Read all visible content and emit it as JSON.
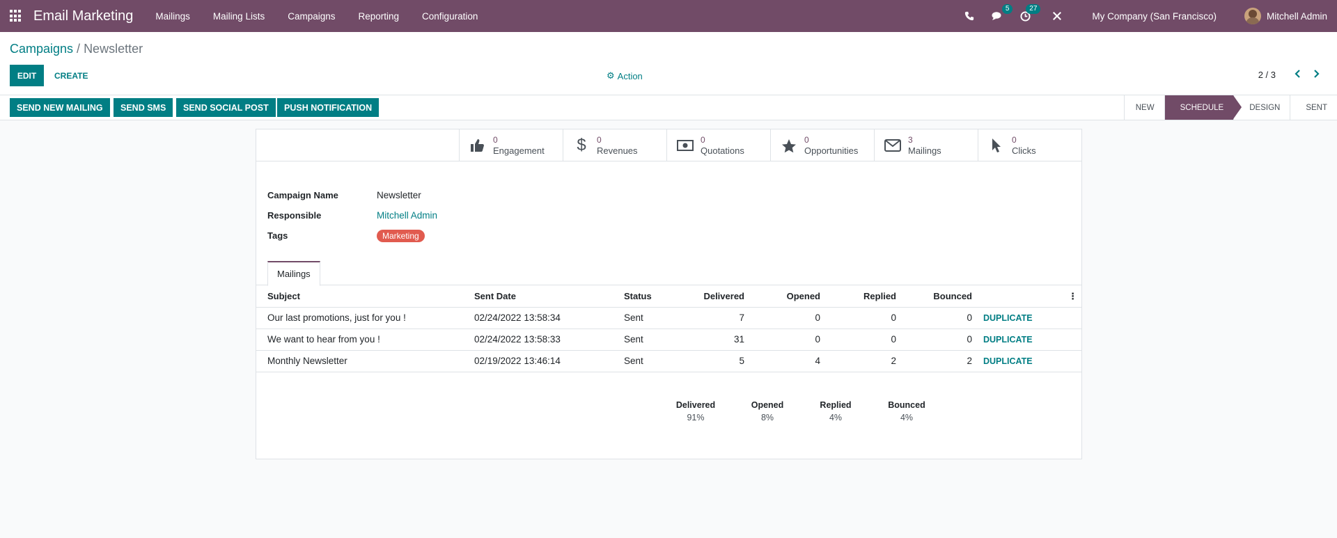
{
  "navbar": {
    "app_title": "Email Marketing",
    "menu": [
      "Mailings",
      "Mailing Lists",
      "Campaigns",
      "Reporting",
      "Configuration"
    ],
    "chat_badge": "5",
    "activity_badge": "27",
    "company": "My Company (San Francisco)",
    "user": "Mitchell Admin"
  },
  "breadcrumb": {
    "parent": "Campaigns",
    "separator": " / ",
    "current": "Newsletter"
  },
  "toolbar": {
    "edit": "EDIT",
    "create": "CREATE",
    "action": "Action",
    "pager": "2 / 3"
  },
  "buttons": [
    "SEND NEW MAILING",
    "SEND SMS",
    "SEND SOCIAL POST",
    "PUSH NOTIFICATION"
  ],
  "stages": [
    "NEW",
    "SCHEDULE",
    "DESIGN",
    "SENT"
  ],
  "active_stage": "SCHEDULE",
  "stats": [
    {
      "value": "0",
      "label": "Engagement",
      "icon": "thumbs-up-icon"
    },
    {
      "value": "0",
      "label": "Revenues",
      "icon": "dollar-icon"
    },
    {
      "value": "0",
      "label": "Quotations",
      "icon": "money-icon"
    },
    {
      "value": "0",
      "label": "Opportunities",
      "icon": "star-icon"
    },
    {
      "value": "3",
      "label": "Mailings",
      "icon": "envelope-icon"
    },
    {
      "value": "0",
      "label": "Clicks",
      "icon": "pointer-icon"
    }
  ],
  "form": {
    "campaign_name_label": "Campaign Name",
    "campaign_name": "Newsletter",
    "responsible_label": "Responsible",
    "responsible": "Mitchell Admin",
    "tags_label": "Tags",
    "tag": "Marketing"
  },
  "tab": "Mailings",
  "table": {
    "headers": [
      "Subject",
      "Sent Date",
      "Status",
      "Delivered",
      "Opened",
      "Replied",
      "Bounced"
    ],
    "rows": [
      {
        "subject": "Our last promotions, just for you !",
        "date": "02/24/2022 13:58:34",
        "status": "Sent",
        "delivered": "7",
        "opened": "0",
        "replied": "0",
        "bounced": "0",
        "action": "DUPLICATE"
      },
      {
        "subject": "We want to hear from you !",
        "date": "02/24/2022 13:58:33",
        "status": "Sent",
        "delivered": "31",
        "opened": "0",
        "replied": "0",
        "bounced": "0",
        "action": "DUPLICATE"
      },
      {
        "subject": "Monthly Newsletter",
        "date": "02/19/2022 13:46:14",
        "status": "Sent",
        "delivered": "5",
        "opened": "4",
        "replied": "2",
        "bounced": "2",
        "action": "DUPLICATE"
      }
    ]
  },
  "totals": [
    {
      "label": "Delivered",
      "value": "91%"
    },
    {
      "label": "Opened",
      "value": "8%"
    },
    {
      "label": "Replied",
      "value": "4%"
    },
    {
      "label": "Bounced",
      "value": "4%"
    }
  ],
  "colors": {
    "brand": "#714B67",
    "accent": "#017e84",
    "tag": "#e15b4f"
  }
}
